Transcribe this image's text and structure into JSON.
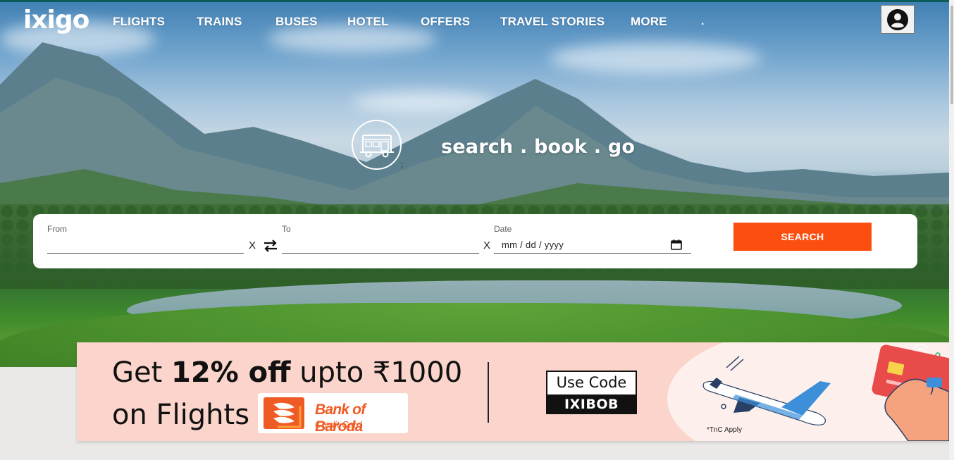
{
  "brand": {
    "logo": "ixigo"
  },
  "nav": {
    "items": [
      {
        "label": "FLIGHTS"
      },
      {
        "label": "TRAINS"
      },
      {
        "label": "BUSES"
      },
      {
        "label": "HOTEL"
      },
      {
        "label": "OFFERS"
      },
      {
        "label": "TRAVEL STORIES"
      },
      {
        "label": "MORE"
      }
    ],
    "trailing_dot": "."
  },
  "hero": {
    "tagline": "search . book . go",
    "stray_mark": ";"
  },
  "search": {
    "from_label": "From",
    "from_value": "",
    "from_clear": "X",
    "to_label": "To",
    "to_value": "",
    "to_clear": "X",
    "date_label": "Date",
    "date_placeholder": "mm / dd / yyyy",
    "button_label": "SEARCH"
  },
  "promo": {
    "line1_prefix": "Get ",
    "line1_bold": "12% off",
    "line1_suffix": " upto ₹1000",
    "line2": "on Flights",
    "bank_name": "Bank of Baroda",
    "bank_sub": "Credit Card",
    "code_label": "Use Code",
    "code_value": "IXIBOB",
    "tnc": "*TnC Apply"
  },
  "colors": {
    "accent": "#fc4e0e",
    "promo_bg": "#fbd5cc",
    "bank_orange": "#f05a24"
  },
  "icons": [
    "account-circle-icon",
    "bus-icon",
    "swap-arrows-icon",
    "calendar-icon",
    "bank-of-baroda-logo",
    "airplane-icon",
    "credit-card-icon"
  ]
}
